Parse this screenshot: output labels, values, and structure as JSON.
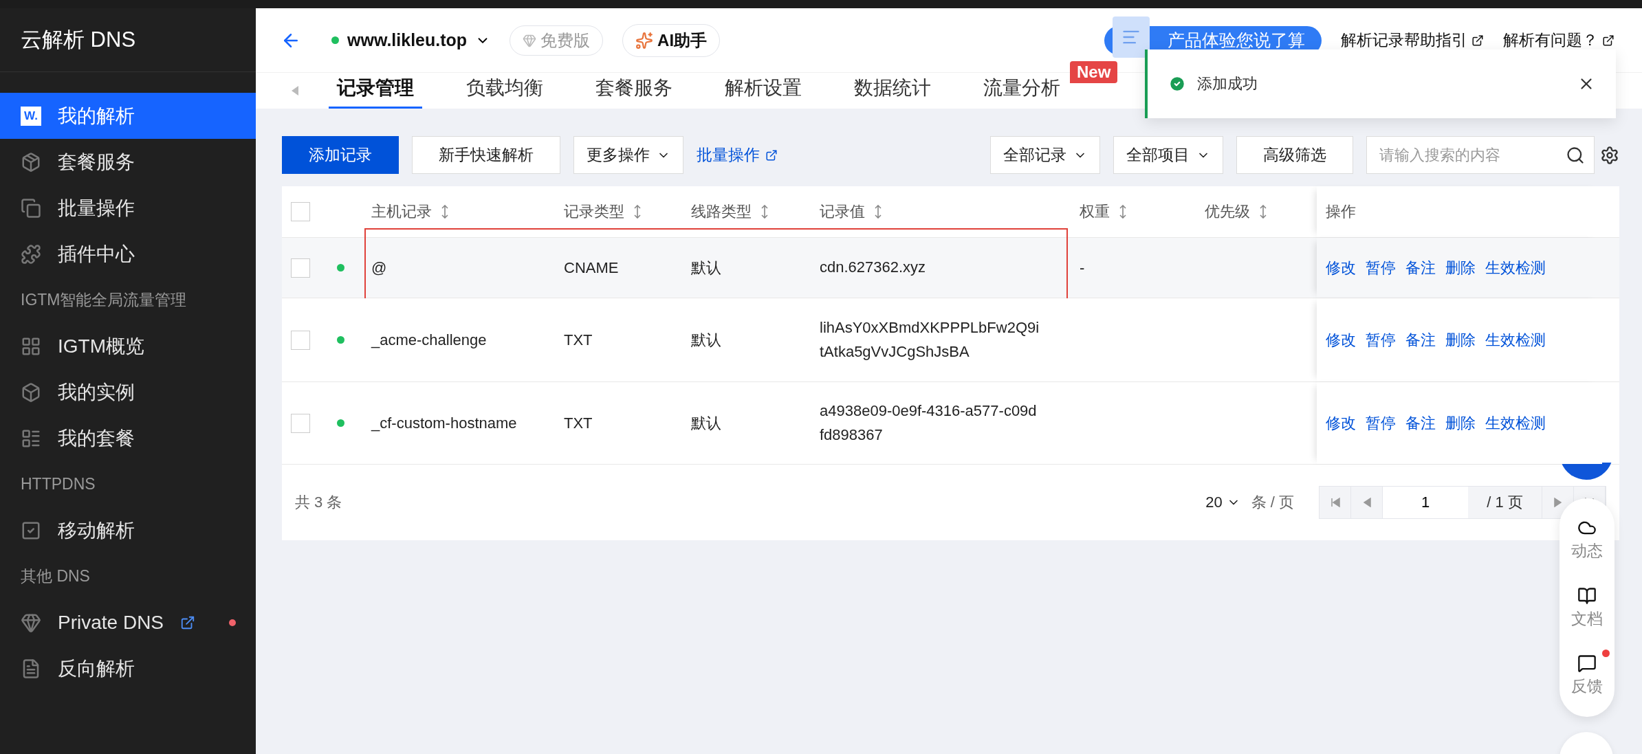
{
  "sidebar": {
    "title": "云解析 DNS",
    "items": [
      {
        "kind": "item",
        "label": "我的解析",
        "selected": true,
        "icon_text": "W."
      },
      {
        "kind": "item",
        "label": "套餐服务",
        "selected": false
      },
      {
        "kind": "item",
        "label": "批量操作",
        "selected": false
      },
      {
        "kind": "item",
        "label": "插件中心",
        "selected": false
      },
      {
        "kind": "section",
        "label": "IGTM智能全局流量管理"
      },
      {
        "kind": "item",
        "label": "IGTM概览",
        "selected": false
      },
      {
        "kind": "item",
        "label": "我的实例",
        "selected": false
      },
      {
        "kind": "item",
        "label": "我的套餐",
        "selected": false
      },
      {
        "kind": "section",
        "label": "HTTPDNS"
      },
      {
        "kind": "item",
        "label": "移动解析",
        "selected": false
      },
      {
        "kind": "section",
        "label": "其他 DNS"
      },
      {
        "kind": "item",
        "label": "Private DNS",
        "selected": false,
        "external": true,
        "dot": true
      },
      {
        "kind": "item",
        "label": "反向解析",
        "selected": false
      }
    ]
  },
  "header": {
    "domain": "www.likleu.top",
    "plan": "免费版",
    "assistant": "AI助手",
    "survey": "产品体验您说了算",
    "links": [
      "解析记录帮助指引",
      "解析有问题？"
    ]
  },
  "tabs": [
    {
      "label": "记录管理",
      "selected": true
    },
    {
      "label": "负载均衡",
      "selected": false
    },
    {
      "label": "套餐服务",
      "selected": false
    },
    {
      "label": "解析设置",
      "selected": false
    },
    {
      "label": "数据统计",
      "selected": false
    },
    {
      "label": "流量分析",
      "selected": false,
      "badge": "New"
    }
  ],
  "toast": {
    "message": "添加成功"
  },
  "toolbar": {
    "primary": "添加记录",
    "quick": "新手快速解析",
    "more": "更多操作",
    "batch": "批量操作",
    "filters": [
      "全部记录",
      "全部项目"
    ],
    "advanced": "高级筛选",
    "search_placeholder": "请输入搜索的内容"
  },
  "table": {
    "select_all_checked": false,
    "columns": [
      {
        "label": "主机记录",
        "sortable": true
      },
      {
        "label": "记录类型",
        "sortable": true
      },
      {
        "label": "线路类型",
        "sortable": true
      },
      {
        "label": "记录值",
        "sortable": true
      },
      {
        "label": "权重",
        "sortable": true
      },
      {
        "label": "优先级",
        "sortable": true
      },
      {
        "label": "操作",
        "sortable": false
      }
    ],
    "rows": [
      {
        "checked": false,
        "enabled": true,
        "highlighted": true,
        "host": "@",
        "type": "CNAME",
        "line": "默认",
        "value": "cdn.627362.xyz",
        "weight": "-",
        "actions": [
          "修改",
          "暂停",
          "备注",
          "删除",
          "生效检测"
        ]
      },
      {
        "checked": false,
        "enabled": true,
        "highlighted": false,
        "host": "_acme-challenge",
        "type": "TXT",
        "line": "默认",
        "value": "lihAsY0xXBmdXKPPPLbFw2Q9itAtka5gVvJCgShJsBA",
        "actions": [
          "修改",
          "暂停",
          "备注",
          "删除",
          "生效检测"
        ]
      },
      {
        "checked": false,
        "enabled": true,
        "highlighted": false,
        "host": "_cf-custom-hostname",
        "type": "TXT",
        "line": "默认",
        "value": "a4938e09-0e9f-4316-a577-c09dfd898367",
        "actions": [
          "修改",
          "暂停",
          "备注",
          "删除",
          "生效检测"
        ]
      }
    ],
    "total": "共 3 条",
    "page_size": "20",
    "page_size_unit": "条 / 页",
    "page": "1",
    "page_total": "/ 1 页"
  },
  "float_panel": [
    {
      "label": "动态",
      "dot": false
    },
    {
      "label": "文档",
      "dot": false
    },
    {
      "label": "反馈",
      "dot": true
    }
  ]
}
